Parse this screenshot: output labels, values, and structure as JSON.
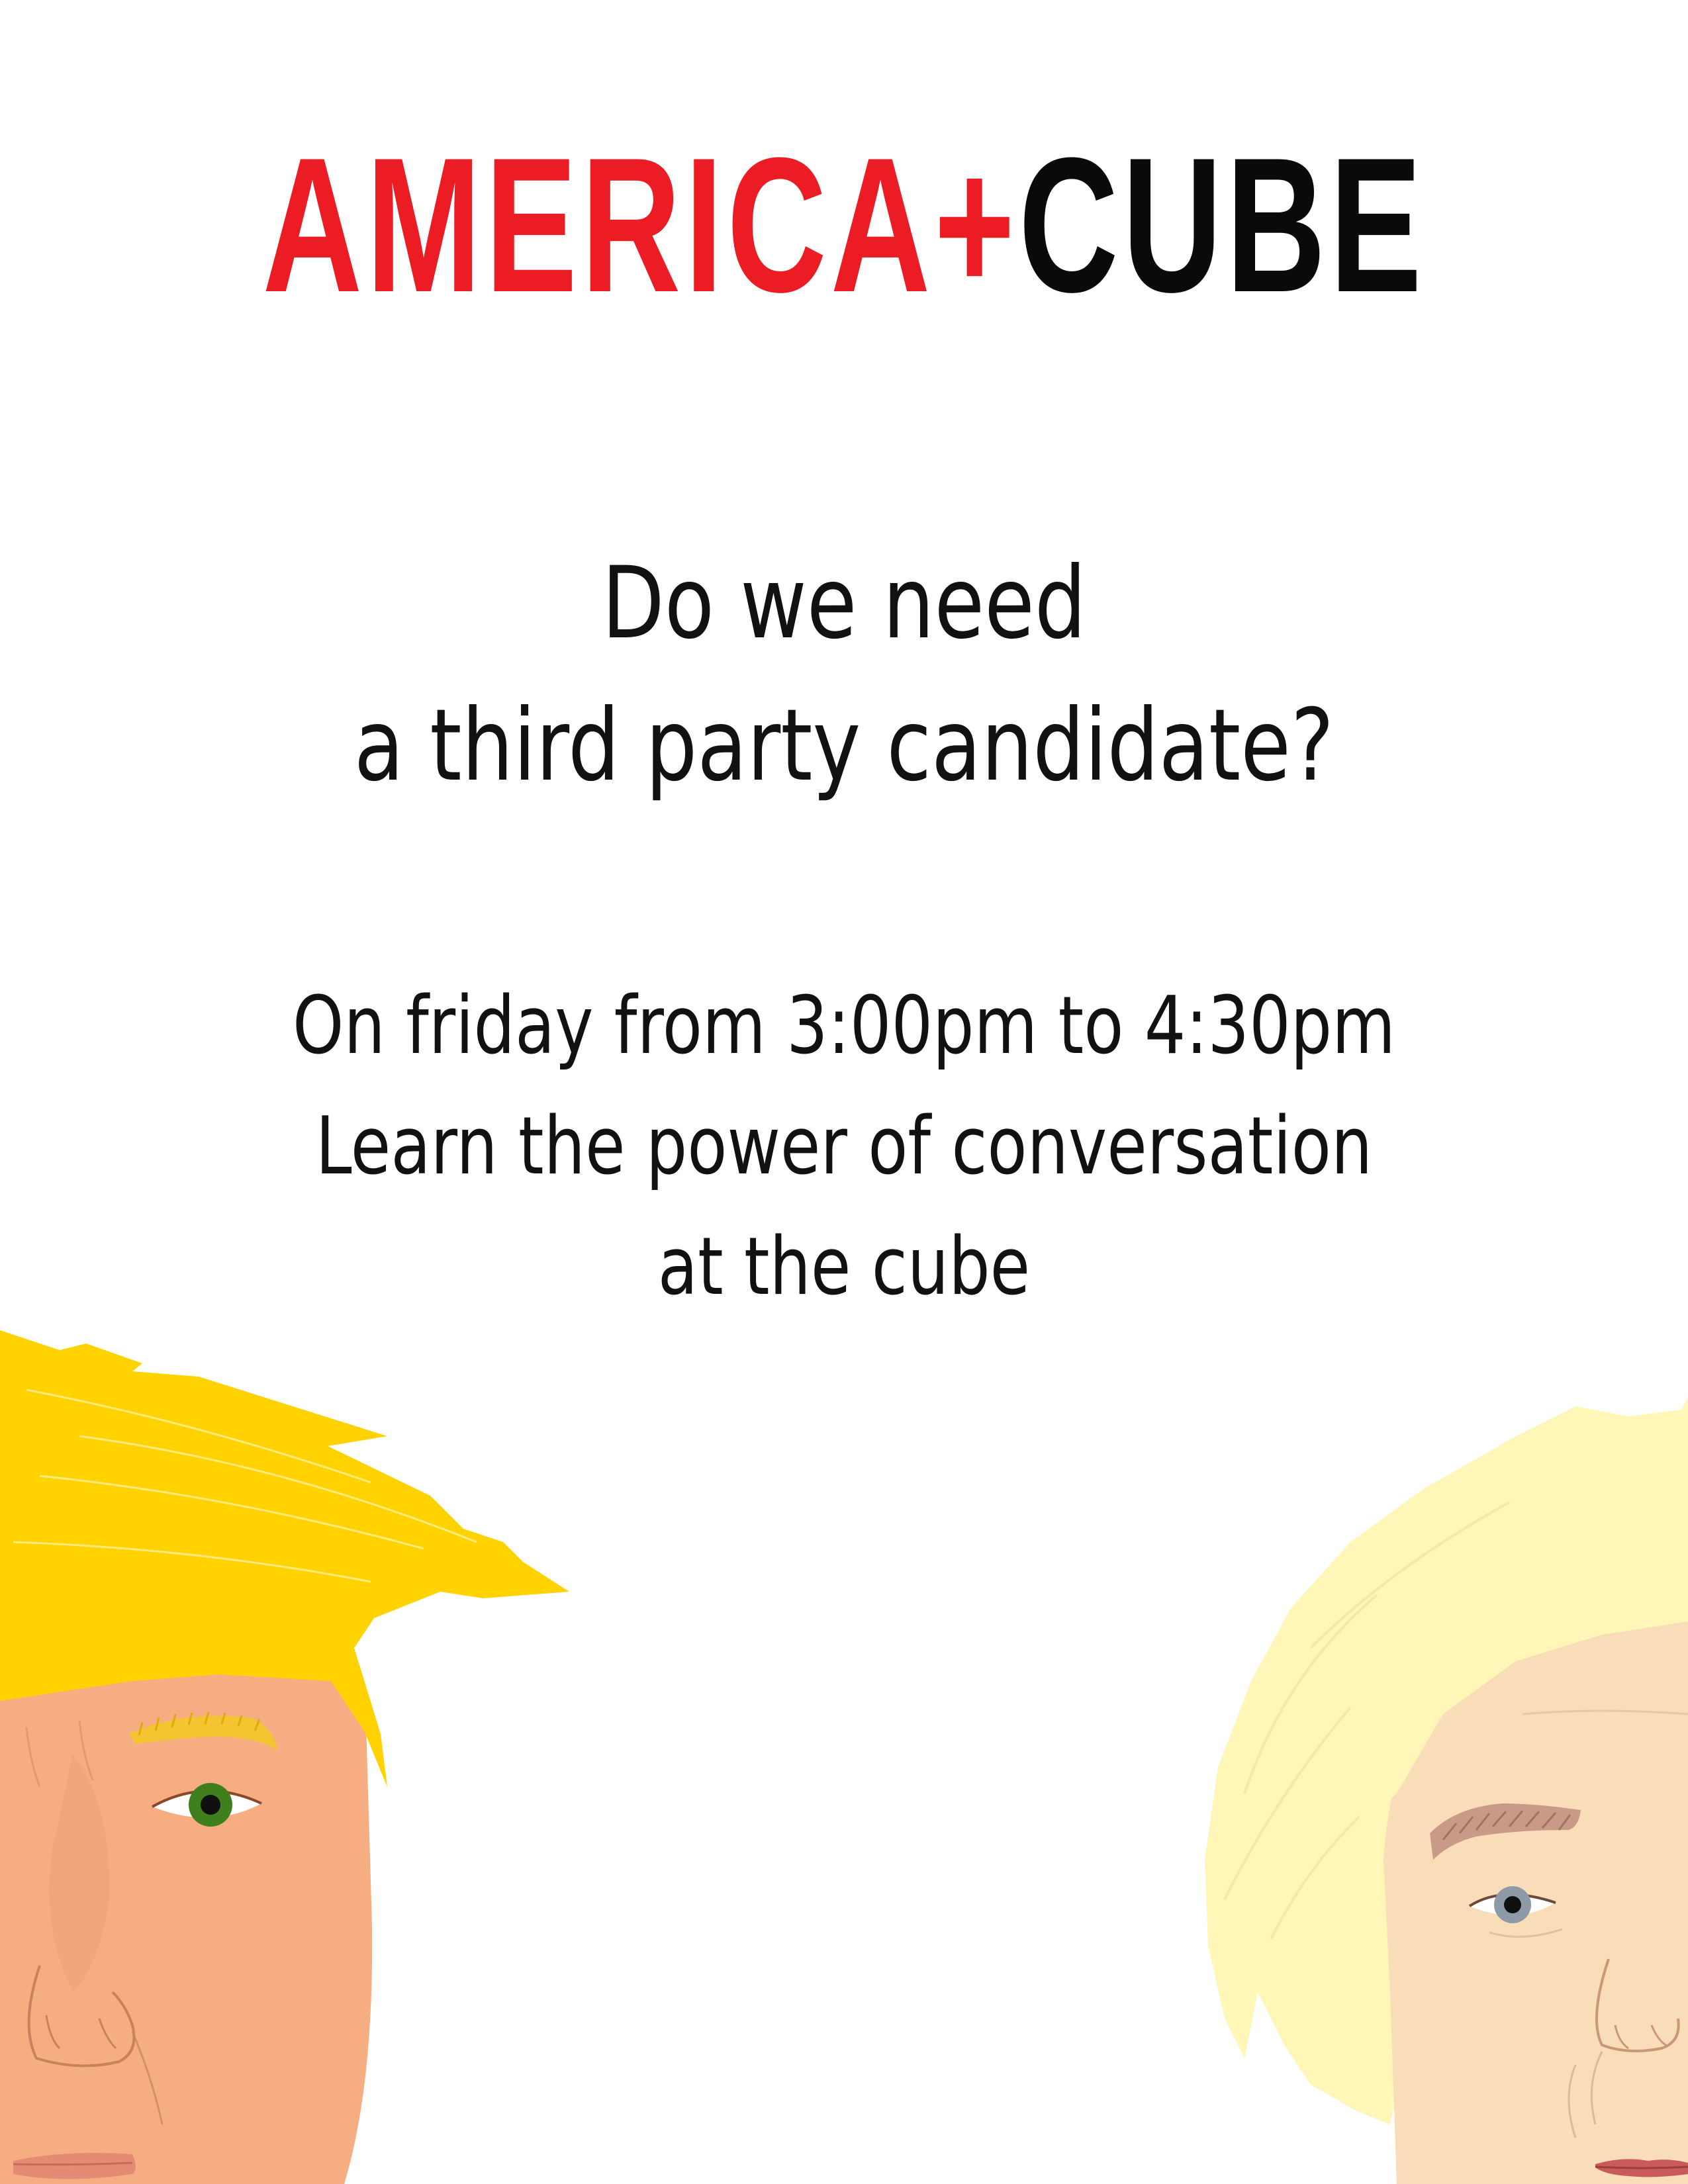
{
  "header": {
    "title_red": "AMERICA+",
    "title_black": "CUBE"
  },
  "question": {
    "line1": "Do we need",
    "line2": "a third party candidate?"
  },
  "event": {
    "line1": "On friday from 3:00pm to 4:30pm",
    "line2": "Learn the power of conversation",
    "line3": "at the cube"
  },
  "colors": {
    "brand_red": "#ec1c24",
    "text_black": "#0a0a0a",
    "left_hair": "#ffd200",
    "left_skin": "#f7ad82",
    "right_hair": "#fff6b8",
    "right_skin": "#f9dcb8"
  },
  "illustrations": {
    "left": "cartoon-face-blond-swept-hair",
    "right": "cartoon-face-pale-blond-bob"
  }
}
